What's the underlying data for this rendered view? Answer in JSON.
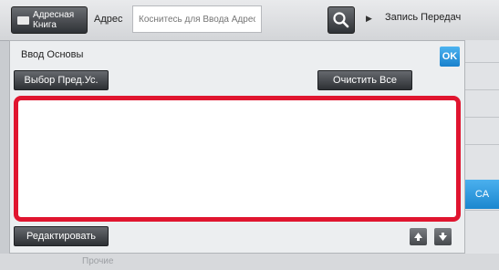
{
  "header": {
    "address_book_label": "Адресная Книга",
    "address_label": "Адрес",
    "address_placeholder": "Коснитесь для Ввода Адреса",
    "tx_log_label": "Запись Передач"
  },
  "dialog": {
    "title": "Ввод Основы",
    "ok_label": "OK",
    "preset_label": "Выбор Пред.Ус.",
    "clear_label": "Очистить Все",
    "edit_label": "Редактировать",
    "text_value": ""
  },
  "side": {
    "ca_label": "CA"
  },
  "bottom": {
    "other_label": "Прочие"
  },
  "colors": {
    "accent": "#1e8ad2",
    "highlight": "#e0152f"
  },
  "icons": [
    "address-book-icon",
    "search-icon",
    "arrow-right-icon",
    "scroll-up-icon",
    "scroll-down-icon"
  ]
}
